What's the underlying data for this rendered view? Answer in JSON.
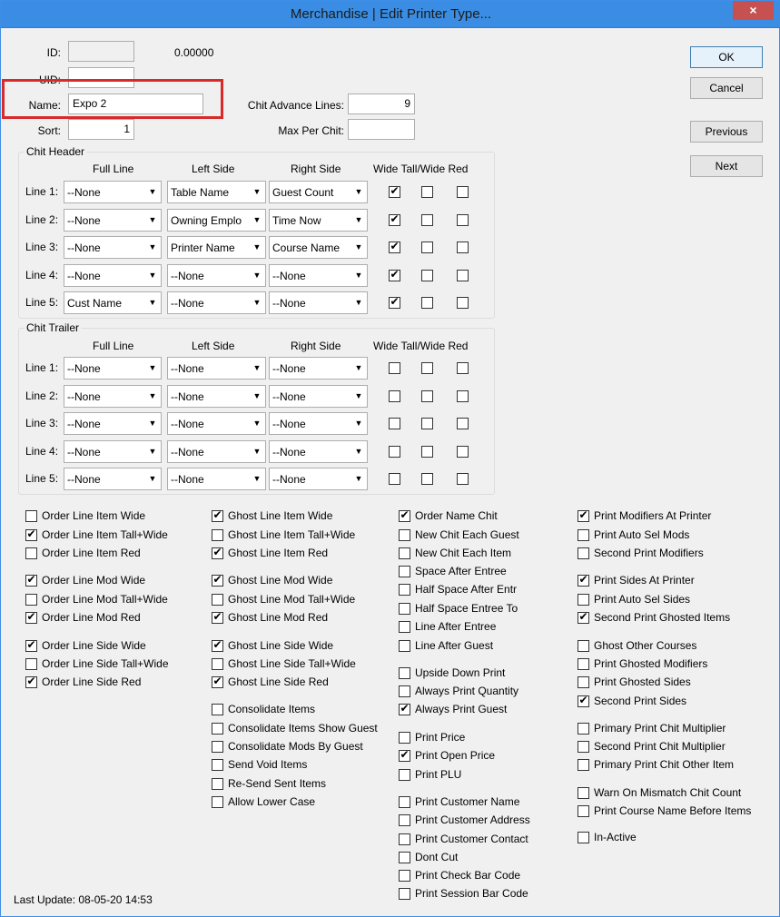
{
  "window": {
    "title": "Merchandise | Edit Printer Type...",
    "close": "×"
  },
  "fields": {
    "id_label": "ID:",
    "id_value": "",
    "id_number": "0.00000",
    "uid_label": "UID:",
    "uid_value": "",
    "name_label": "Name:",
    "name_value": "Expo 2",
    "sort_label": "Sort:",
    "sort_value": "1",
    "chit_adv_label": "Chit Advance Lines:",
    "chit_adv_value": "9",
    "max_per_chit_label": "Max Per Chit:",
    "max_per_chit_value": ""
  },
  "buttons": {
    "ok": "OK",
    "cancel": "Cancel",
    "previous": "Previous",
    "next": "Next"
  },
  "header": {
    "title": "Chit Header",
    "cols": {
      "full": "Full Line",
      "left": "Left Side",
      "right": "Right Side",
      "flags": "Wide Tall/Wide Red"
    },
    "rows": [
      {
        "label": "Line 1:",
        "full": "--None",
        "left": "Table Name",
        "right": "Guest Count",
        "wide": true,
        "tall": false,
        "red": false
      },
      {
        "label": "Line 2:",
        "full": "--None",
        "left": "Owning Emplo",
        "right": "Time Now",
        "wide": true,
        "tall": false,
        "red": false
      },
      {
        "label": "Line 3:",
        "full": "--None",
        "left": "Printer Name",
        "right": "Course Name",
        "wide": true,
        "tall": false,
        "red": false
      },
      {
        "label": "Line 4:",
        "full": "--None",
        "left": "--None",
        "right": "--None",
        "wide": true,
        "tall": false,
        "red": false
      },
      {
        "label": "Line 5:",
        "full": "Cust Name",
        "left": "--None",
        "right": "--None",
        "wide": true,
        "tall": false,
        "red": false
      }
    ]
  },
  "trailer": {
    "title": "Chit Trailer",
    "cols": {
      "full": "Full Line",
      "left": "Left Side",
      "right": "Right Side",
      "flags": "Wide Tall/Wide Red"
    },
    "rows": [
      {
        "label": "Line 1:",
        "full": "--None",
        "left": "--None",
        "right": "--None",
        "wide": false,
        "tall": false,
        "red": false
      },
      {
        "label": "Line 2:",
        "full": "--None",
        "left": "--None",
        "right": "--None",
        "wide": false,
        "tall": false,
        "red": false
      },
      {
        "label": "Line 3:",
        "full": "--None",
        "left": "--None",
        "right": "--None",
        "wide": false,
        "tall": false,
        "red": false
      },
      {
        "label": "Line 4:",
        "full": "--None",
        "left": "--None",
        "right": "--None",
        "wide": false,
        "tall": false,
        "red": false
      },
      {
        "label": "Line 5:",
        "full": "--None",
        "left": "--None",
        "right": "--None",
        "wide": false,
        "tall": false,
        "red": false
      }
    ]
  },
  "options": {
    "col1": [
      {
        "label": "Order Line Item Wide",
        "checked": false
      },
      {
        "label": "Order Line Item Tall+Wide",
        "checked": true
      },
      {
        "label": "Order Line Item Red",
        "checked": false
      },
      {
        "label": "Order Line Mod Wide",
        "checked": true
      },
      {
        "label": "Order Line Mod Tall+Wide",
        "checked": false
      },
      {
        "label": "Order Line Mod Red",
        "checked": true
      },
      {
        "label": "Order Line Side Wide",
        "checked": true
      },
      {
        "label": "Order Line Side Tall+Wide",
        "checked": false
      },
      {
        "label": "Order Line Side Red",
        "checked": true
      }
    ],
    "col2": [
      {
        "label": "Ghost Line Item Wide",
        "checked": true
      },
      {
        "label": "Ghost Line Item Tall+Wide",
        "checked": false
      },
      {
        "label": "Ghost Line Item Red",
        "checked": true
      },
      {
        "label": "Ghost Line Mod Wide",
        "checked": true
      },
      {
        "label": "Ghost Line Mod Tall+Wide",
        "checked": false
      },
      {
        "label": "Ghost Line Mod Red",
        "checked": true
      },
      {
        "label": "Ghost Line Side Wide",
        "checked": true
      },
      {
        "label": "Ghost Line Side Tall+Wide",
        "checked": false
      },
      {
        "label": "Ghost Line Side Red",
        "checked": true
      },
      {
        "label": "Consolidate Items",
        "checked": false
      },
      {
        "label": "Consolidate Items Show Guest",
        "checked": false
      },
      {
        "label": "Consolidate Mods By Guest",
        "checked": false
      },
      {
        "label": "Send Void Items",
        "checked": false
      },
      {
        "label": "Re-Send Sent Items",
        "checked": false
      },
      {
        "label": "Allow Lower Case",
        "checked": false
      }
    ],
    "col3": [
      {
        "label": "Order Name Chit",
        "checked": true
      },
      {
        "label": "New Chit Each Guest",
        "checked": false
      },
      {
        "label": "New Chit Each Item",
        "checked": false
      },
      {
        "label": "Space After Entree",
        "checked": false
      },
      {
        "label": "Half Space After Entr",
        "checked": false
      },
      {
        "label": "Half Space Entree To",
        "checked": false
      },
      {
        "label": "Line After Entree",
        "checked": false
      },
      {
        "label": "Line After Guest",
        "checked": false
      },
      {
        "label": "Upside Down Print",
        "checked": false
      },
      {
        "label": "Always Print Quantity",
        "checked": false
      },
      {
        "label": "Always Print Guest",
        "checked": true
      },
      {
        "label": "Print Price",
        "checked": false
      },
      {
        "label": "Print Open Price",
        "checked": true
      },
      {
        "label": "Print PLU",
        "checked": false
      },
      {
        "label": "Print Customer Name",
        "checked": false
      },
      {
        "label": "Print Customer Address",
        "checked": false
      },
      {
        "label": "Print Customer Contact",
        "checked": false
      },
      {
        "label": "Dont Cut",
        "checked": false
      },
      {
        "label": "Print Check Bar Code",
        "checked": false
      },
      {
        "label": "Print Session Bar Code",
        "checked": false
      }
    ],
    "col4": [
      {
        "label": "Print Modifiers At Printer",
        "checked": true
      },
      {
        "label": "Print Auto Sel Mods",
        "checked": false
      },
      {
        "label": "Second Print Modifiers",
        "checked": false
      },
      {
        "label": "Print Sides At Printer",
        "checked": true
      },
      {
        "label": "Print Auto Sel Sides",
        "checked": false
      },
      {
        "label": "Second Print Ghosted Items",
        "checked": true
      },
      {
        "label": "Ghost Other Courses",
        "checked": false
      },
      {
        "label": "Print Ghosted Modifiers",
        "checked": false
      },
      {
        "label": "Print Ghosted Sides",
        "checked": false
      },
      {
        "label": "Second Print Sides",
        "checked": true
      },
      {
        "label": "Primary Print Chit Multiplier",
        "checked": false
      },
      {
        "label": "Second Print Chit Multiplier",
        "checked": false
      },
      {
        "label": "Primary Print Chit Other Item",
        "checked": false
      },
      {
        "label": "Warn On Mismatch Chit Count",
        "checked": false
      },
      {
        "label": "Print Course Name Before Items",
        "checked": false
      },
      {
        "label": "In-Active",
        "checked": false
      }
    ]
  },
  "status": {
    "last_update": "Last Update: 08-05-20 14:53"
  },
  "icons": {
    "dropdown": "chevron-down-icon",
    "close": "close-icon",
    "check": "checkmark-icon"
  }
}
